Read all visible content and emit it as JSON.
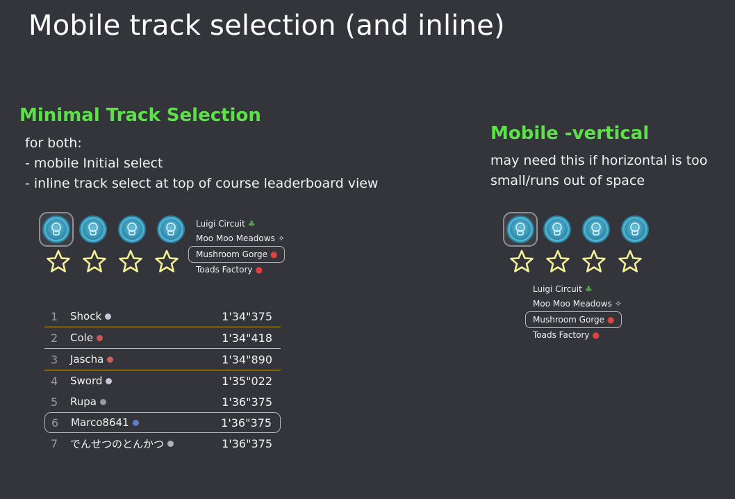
{
  "page_title": "Mobile track selection (and inline)",
  "minimal": {
    "heading": "Minimal Track Selection",
    "desc_lines": [
      "for both:",
      "- mobile Initial select",
      "- inline track select at top of course leaderboard view"
    ]
  },
  "vertical": {
    "heading": "Mobile -vertical",
    "desc_lines": [
      "may need this if horizontal is too",
      "small/runs out of space"
    ]
  },
  "tracks": [
    {
      "label": "Luigi Circuit",
      "icon": "luigi-icon",
      "glyph": "♣",
      "color": "#4fa44a"
    },
    {
      "label": "Moo Moo Meadows",
      "icon": "cow-icon",
      "glyph": "✧",
      "color": "#dcdcdc"
    },
    {
      "label": "Mushroom Gorge",
      "icon": "mushroom-icon",
      "glyph": "⬤",
      "color": "#e04040"
    },
    {
      "label": "Toads Factory",
      "icon": "toad-icon",
      "glyph": "⬤",
      "color": "#e04040"
    }
  ],
  "leaderboard": [
    {
      "rank": "1",
      "name": "Shock",
      "time": "1'34\"375",
      "flag": "#c6c6d8"
    },
    {
      "rank": "2",
      "name": "Cole",
      "time": "1'34\"418",
      "flag": "#c45a5a"
    },
    {
      "rank": "3",
      "name": "Jascha",
      "time": "1'34\"890",
      "flag": "#c86060"
    },
    {
      "rank": "4",
      "name": "Sword",
      "time": "1'35\"022",
      "flag": "#c6c6d8"
    },
    {
      "rank": "5",
      "name": "Rupa",
      "time": "1'36\"375",
      "flag": "#9a9aa0"
    },
    {
      "rank": "6",
      "name": "Marco8641",
      "time": "1'36\"375",
      "flag": "#5a7ed0"
    },
    {
      "rank": "7",
      "name": "でんせつのとんかつ",
      "time": "1'36\"375",
      "flag": "#b0b0b4"
    }
  ]
}
